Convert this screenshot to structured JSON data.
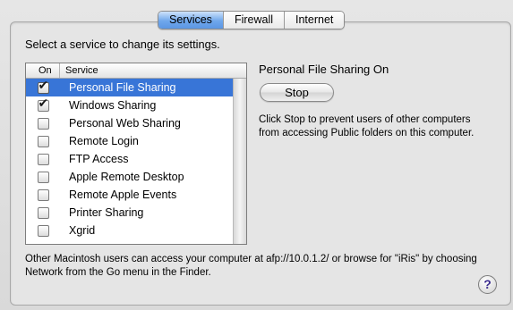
{
  "tabs": [
    {
      "label": "Services",
      "active": true
    },
    {
      "label": "Firewall",
      "active": false
    },
    {
      "label": "Internet",
      "active": false
    }
  ],
  "instruction": "Select a service to change its settings.",
  "service_list": {
    "headers": {
      "on": "On",
      "service": "Service"
    },
    "rows": [
      {
        "label": "Personal File Sharing",
        "checked": true,
        "selected": true
      },
      {
        "label": "Windows Sharing",
        "checked": true,
        "selected": false
      },
      {
        "label": "Personal Web Sharing",
        "checked": false,
        "selected": false
      },
      {
        "label": "Remote Login",
        "checked": false,
        "selected": false
      },
      {
        "label": "FTP Access",
        "checked": false,
        "selected": false
      },
      {
        "label": "Apple Remote Desktop",
        "checked": false,
        "selected": false
      },
      {
        "label": "Remote Apple Events",
        "checked": false,
        "selected": false
      },
      {
        "label": "Printer Sharing",
        "checked": false,
        "selected": false
      },
      {
        "label": "Xgrid",
        "checked": false,
        "selected": false
      }
    ]
  },
  "detail": {
    "status": "Personal File Sharing On",
    "stop_label": "Stop",
    "description": "Click Stop to prevent users of other computers from accessing Public folders on this computer."
  },
  "footer_text": "Other Macintosh users can access your computer at afp://10.0.1.2/ or browse for \"iRis\" by choosing Network from the Go menu in the Finder.",
  "help_label": "?",
  "colors": {
    "selection": "#3875d7",
    "tab_active": "#6fa7ec"
  }
}
